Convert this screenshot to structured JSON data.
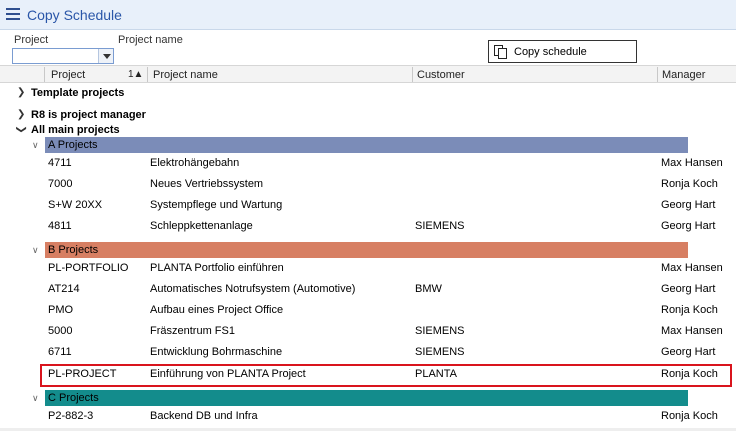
{
  "window": {
    "title": "Copy Schedule"
  },
  "filters": {
    "project_label": "Project",
    "project_name_label": "Project name",
    "project_value": ""
  },
  "toolbar": {
    "copy_label": "Copy schedule"
  },
  "table": {
    "columns": [
      "Project",
      "Project name",
      "Customer",
      "Manager"
    ],
    "sort_indicator": "1▲"
  },
  "groups": {
    "template": "Template projects",
    "r8": "R8  is project manager",
    "all": "All main projects"
  },
  "categories": {
    "a": "A Projects",
    "b": "B Projects",
    "c": "C Projects"
  },
  "rows": [
    {
      "id": "4711",
      "name": "Elektrohängebahn",
      "customer": "",
      "manager": "Max Hansen"
    },
    {
      "id": "7000",
      "name": "Neues Vertriebssystem",
      "customer": "",
      "manager": "Ronja Koch"
    },
    {
      "id": "S+W 20XX",
      "name": "Systempflege und Wartung",
      "customer": "",
      "manager": "Georg Hart"
    },
    {
      "id": "4811",
      "name": "Schleppkettenanlage",
      "customer": "SIEMENS",
      "manager": "Georg Hart"
    },
    {
      "id": "PL-PORTFOLIO",
      "name": "PLANTA Portfolio einführen",
      "customer": "",
      "manager": "Max Hansen"
    },
    {
      "id": "AT214",
      "name": "Automatisches Notrufsystem (Automotive)",
      "customer": "BMW",
      "manager": "Georg Hart"
    },
    {
      "id": "PMO",
      "name": "Aufbau eines Project Office",
      "customer": "",
      "manager": "Ronja Koch"
    },
    {
      "id": "5000",
      "name": "Fräszentrum FS1",
      "customer": "SIEMENS",
      "manager": "Max Hansen"
    },
    {
      "id": "6711",
      "name": "Entwicklung Bohrmaschine",
      "customer": "SIEMENS",
      "manager": "Georg Hart"
    },
    {
      "id": "PL-PROJECT",
      "name": "Einführung von PLANTA Project",
      "customer": "PLANTA",
      "manager": "Ronja Koch"
    },
    {
      "id": "P2-882-3",
      "name": "Backend DB und Infra",
      "customer": "",
      "manager": "Ronja Koch"
    }
  ],
  "colors": {
    "a_projects": "#7b8cb8",
    "b_projects": "#d77f63",
    "c_projects": "#138c8c",
    "highlight": "#d9141d",
    "title": "#2a56a8"
  }
}
